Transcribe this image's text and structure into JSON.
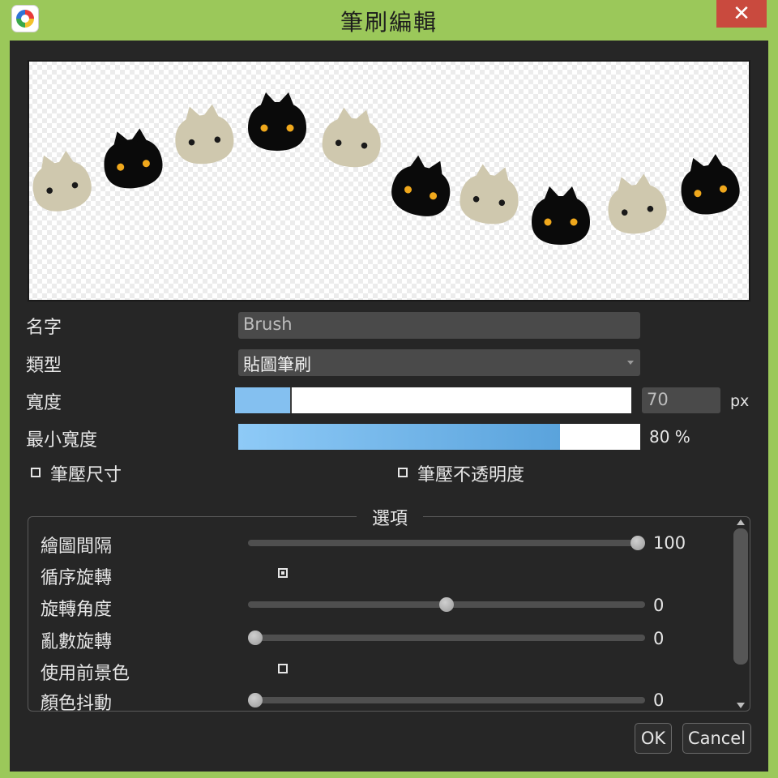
{
  "window": {
    "title": "筆刷編輯",
    "close_label": "✕",
    "app_icon": "app-logo-icon"
  },
  "form": {
    "name_label": "名字",
    "name_value": "Brush",
    "type_label": "類型",
    "type_value": "貼圖筆刷",
    "width_label": "寬度",
    "width_value": "70",
    "width_unit": "px",
    "width_fill_fraction": 0.14,
    "min_width_label": "最小寬度",
    "min_width_value": "80 %",
    "min_width_fraction": 0.8,
    "pressure_size_label": "筆壓尺寸",
    "pressure_size_checked": false,
    "pressure_opacity_label": "筆壓不透明度",
    "pressure_opacity_checked": false
  },
  "options": {
    "title": "選項",
    "draw_interval_label": "繪圖間隔",
    "draw_interval_value": "100",
    "draw_interval_fraction": 1.0,
    "sequential_rotation_label": "循序旋轉",
    "sequential_rotation_checked": true,
    "rotation_angle_label": "旋轉角度",
    "rotation_angle_value": "0",
    "rotation_angle_fraction": 0.5,
    "random_rotation_label": "亂數旋轉",
    "random_rotation_value": "0",
    "random_rotation_fraction": 0.0,
    "use_foreground_label": "使用前景色",
    "use_foreground_checked": false,
    "color_jitter_label": "顏色抖動",
    "color_jitter_value": "0",
    "color_jitter_fraction": 0.0
  },
  "buttons": {
    "ok": "OK",
    "cancel": "Cancel"
  },
  "colors": {
    "accent_green": "#9bc85a",
    "close_red": "#c94a3e",
    "cat_black": "#0a0a0a",
    "cat_beige": "#cfc8ae",
    "eye_orange": "#f0a81c",
    "eye_dark": "#1a1a1a",
    "bar_blue": "#84c0f0"
  },
  "preview": {
    "icon": "cat-head-stamp-icon"
  }
}
